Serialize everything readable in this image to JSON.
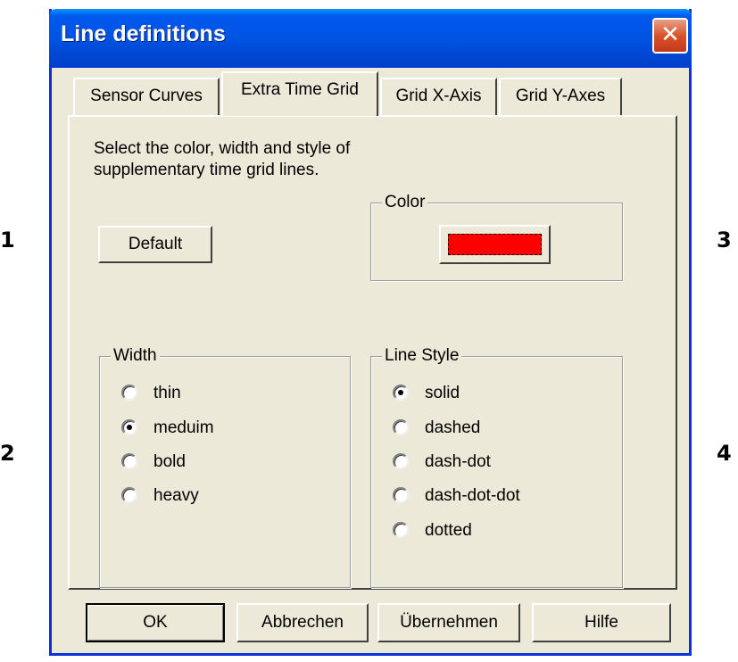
{
  "annotations": [
    "1",
    "2",
    "3",
    "4"
  ],
  "window": {
    "title": "Line definitions",
    "close_glyph": "✕"
  },
  "tabs": [
    {
      "label": "Sensor Curves",
      "active": false
    },
    {
      "label": "Extra Time Grid",
      "active": true
    },
    {
      "label": "Grid X-Axis",
      "active": false
    },
    {
      "label": "Grid Y-Axes",
      "active": false
    }
  ],
  "panel": {
    "description": "Select the color, width and style of supplementary time grid lines.",
    "default_button": "Default"
  },
  "color_group": {
    "label": "Color",
    "value": "#FF0000"
  },
  "width_group": {
    "label": "Width",
    "options": [
      "thin",
      "meduim",
      "bold",
      "heavy"
    ],
    "selected": "meduim"
  },
  "linestyle_group": {
    "label": "Line Style",
    "options": [
      "solid",
      "dashed",
      "dash-dot",
      "dash-dot-dot",
      "dotted"
    ],
    "selected": "solid"
  },
  "buttons": {
    "ok": "OK",
    "cancel": "Abbrechen",
    "apply": "Übernehmen",
    "help": "Hilfe"
  }
}
